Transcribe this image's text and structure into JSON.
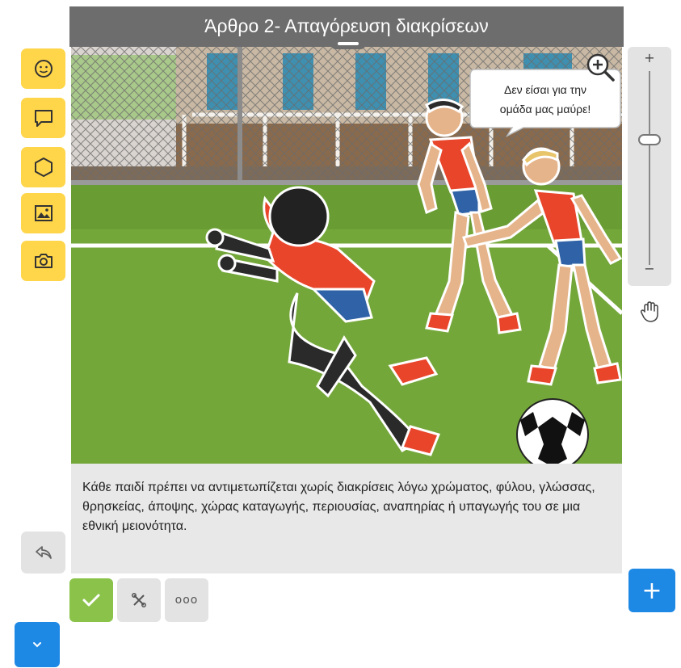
{
  "panel": {
    "title": "Άρθρο 2- Απαγόρευση διακρίσεων",
    "speech_bubble": [
      "Δεν είσαι για την",
      "ομάδα μας  μαύρε!"
    ],
    "caption": "Κάθε παιδί πρέπει να αντιμετωπίζεται χωρίς διακρίσεις λόγω χρώματος, φύλου, γλώσσας, θρησκείας, άποψης, χώρας καταγωγής, περιουσίας, αναπηρίας ή υπαγωγής του σε μια εθνική μειονότητα."
  },
  "tools": [
    {
      "name": "character",
      "icon": "smiley-icon"
    },
    {
      "name": "speech-bubble",
      "icon": "speech-bubble-icon"
    },
    {
      "name": "shape",
      "icon": "hexagon-icon"
    },
    {
      "name": "image",
      "icon": "image-icon"
    },
    {
      "name": "camera",
      "icon": "camera-icon"
    }
  ],
  "zoom": {
    "plus_label": "+",
    "minus_label": "−",
    "level": 0.55
  },
  "actions": {
    "confirm_icon": "check-icon",
    "cancel_icon": "shuffle-x-icon",
    "more_label": "ooo",
    "add_label": "+",
    "undo_icon": "undo-icon",
    "collapse_icon": "chevron-down-icon"
  },
  "colors": {
    "tool_yellow": "#ffd54a",
    "title_bar": "#6d6d6d",
    "confirm_green": "#8bc34a",
    "primary_blue": "#1e88e5",
    "grass": "#74a73a",
    "jersey_red": "#e8452b"
  }
}
